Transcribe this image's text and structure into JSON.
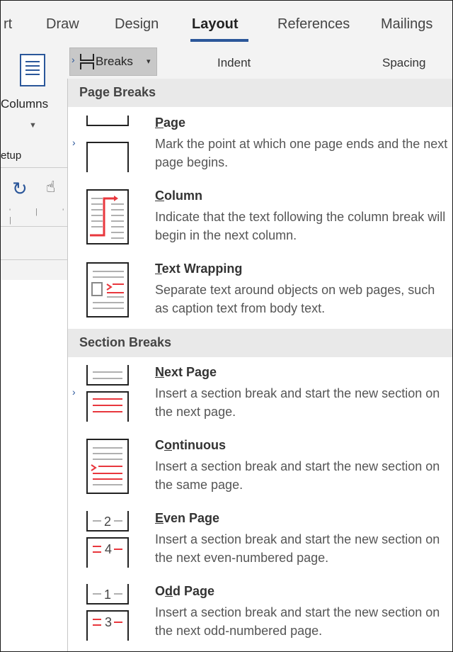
{
  "tabs": [
    {
      "label": "rt",
      "active": false
    },
    {
      "label": "Draw",
      "active": false
    },
    {
      "label": "Design",
      "active": false
    },
    {
      "label": "Layout",
      "active": true
    },
    {
      "label": "References",
      "active": false
    },
    {
      "label": "Mailings",
      "active": false
    }
  ],
  "ribbon": {
    "columns_label": "Columns",
    "setup_label": "etup",
    "breaks_label": "Breaks",
    "indent_label": "Indent",
    "spacing_label": "Spacing"
  },
  "menu": {
    "page_breaks_header": "Page Breaks",
    "section_breaks_header": "Section Breaks",
    "items": [
      {
        "title": "Page",
        "desc": "Mark the point at which one page ends and the next page begins."
      },
      {
        "title": "Column",
        "desc": "Indicate that the text following the column break will begin in the next column."
      },
      {
        "title": "Text Wrapping",
        "desc": "Separate text around objects on web pages, such as caption text from body text."
      },
      {
        "title": "Next Page",
        "desc": "Insert a section break and start the new section on the next page."
      },
      {
        "title": "Continuous",
        "desc": "Insert a section break and start the new section on the same page."
      },
      {
        "title": "Even Page",
        "desc": "Insert a section break and start the new section on the next even-numbered page."
      },
      {
        "title": "Odd Page",
        "desc": "Insert a section break and start the new section on the next odd-numbered page."
      }
    ],
    "icon_numbers": {
      "even_top": "2",
      "even_bottom": "4",
      "odd_top": "1",
      "odd_bottom": "3"
    }
  },
  "colors": {
    "accent": "#2b579a",
    "break_red": "#e8373d",
    "line_gray": "#b0b0b0"
  }
}
